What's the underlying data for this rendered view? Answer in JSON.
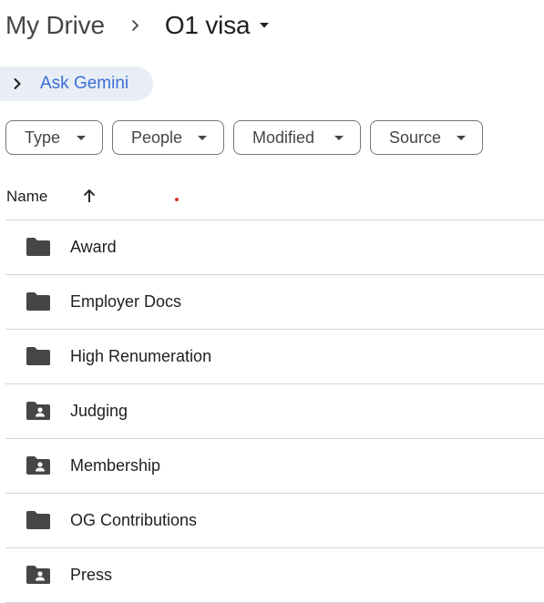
{
  "breadcrumb": {
    "root_label": "My Drive",
    "separator_icon": "chevron-right-icon",
    "current_label": "O1 visa",
    "current_caret_icon": "caret-down-icon"
  },
  "gemini": {
    "label": "Ask Gemini",
    "icon": "chevron-right-icon",
    "accent_color": "#3b6fd6",
    "background_color": "#e9eef6"
  },
  "filters": [
    {
      "label": "Type"
    },
    {
      "label": "People"
    },
    {
      "label": "Modified"
    },
    {
      "label": "Source"
    }
  ],
  "columns": {
    "name_label": "Name",
    "sort_icon": "arrow-up-icon"
  },
  "items": [
    {
      "name": "Award",
      "icon": "folder-icon"
    },
    {
      "name": "Employer Docs",
      "icon": "folder-icon"
    },
    {
      "name": "High Renumeration",
      "icon": "folder-icon"
    },
    {
      "name": "Judging",
      "icon": "shared-folder-icon"
    },
    {
      "name": "Membership",
      "icon": "shared-folder-icon"
    },
    {
      "name": "OG Contributions",
      "icon": "folder-icon"
    },
    {
      "name": "Press",
      "icon": "shared-folder-icon"
    }
  ]
}
